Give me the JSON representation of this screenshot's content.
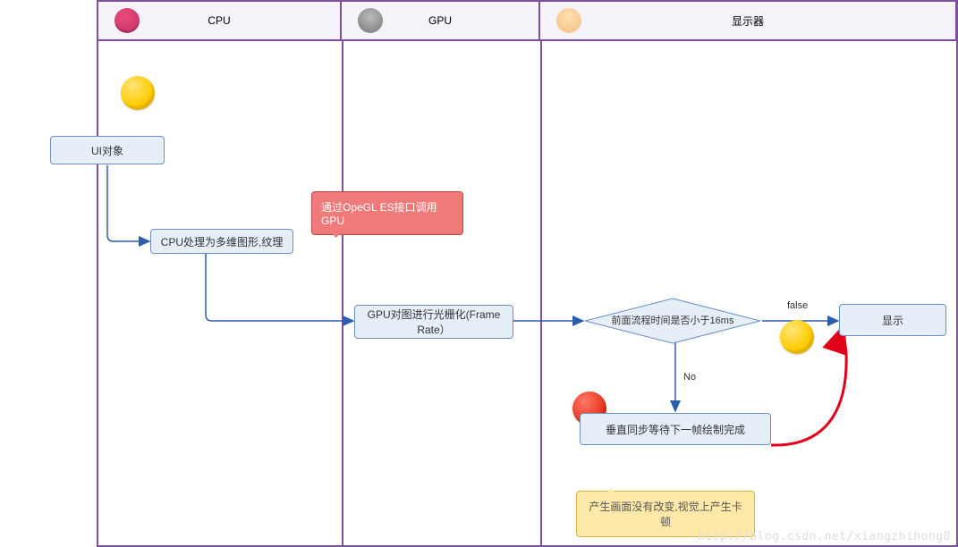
{
  "lanes": {
    "cpu": "CPU",
    "gpu": "GPU",
    "display": "显示器"
  },
  "nodes": {
    "ui_object": "UI对象",
    "cpu_process": "CPU处理为多维图形,纹理",
    "callout_opengl": "通过OpeGL ES接口调用GPU",
    "gpu_raster": "GPU对图进行光栅化(Frame Rate）",
    "decision_16ms": "前面流程时间是否小于16ms",
    "display_node": "显示",
    "vsync_wait": "垂直同步等待下一帧绘制完成",
    "callout_stutter": "产生画面没有改变,视觉上产生卡顿"
  },
  "edge_labels": {
    "dec_false": "false",
    "dec_no": "No"
  },
  "watermark": "http://blog.csdn.net/xiangzhihong8"
}
